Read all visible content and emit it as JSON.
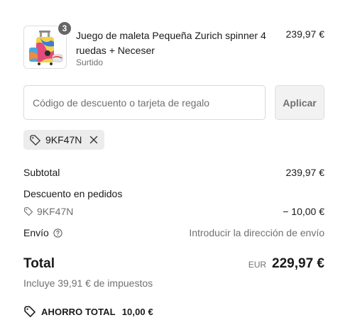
{
  "product": {
    "quantity": "3",
    "title": "Juego de maleta Pequeña Zurich spinner 4 ruedas + Neceser",
    "variant": "Surtido",
    "price": "239,97 €",
    "image_icon": "suitcase-set-image"
  },
  "discount": {
    "placeholder": "Código de descuento o tarjeta de regalo",
    "value": "",
    "apply_label": "Aplicar"
  },
  "applied_code": {
    "code": "9KF47N",
    "icon": "tag-icon",
    "remove_icon": "close-icon"
  },
  "summary": {
    "subtotal_label": "Subtotal",
    "subtotal_value": "239,97 €",
    "order_discount_label": "Descuento en pedidos",
    "order_discount_code": "9KF47N",
    "order_discount_value": "− 10,00 €",
    "shipping_label": "Envío",
    "shipping_value": "Introducir la dirección de envío"
  },
  "total": {
    "label": "Total",
    "currency": "EUR",
    "amount": "229,97 €",
    "tax_note": "Incluye 39,91 € de impuestos"
  },
  "savings": {
    "label": "AHORRO TOTAL",
    "amount": "10,00 €"
  },
  "colors": {
    "badge": "#666666",
    "chip_bg": "#ececec",
    "button_bg": "#f2f2f2",
    "muted_text": "#707070"
  }
}
